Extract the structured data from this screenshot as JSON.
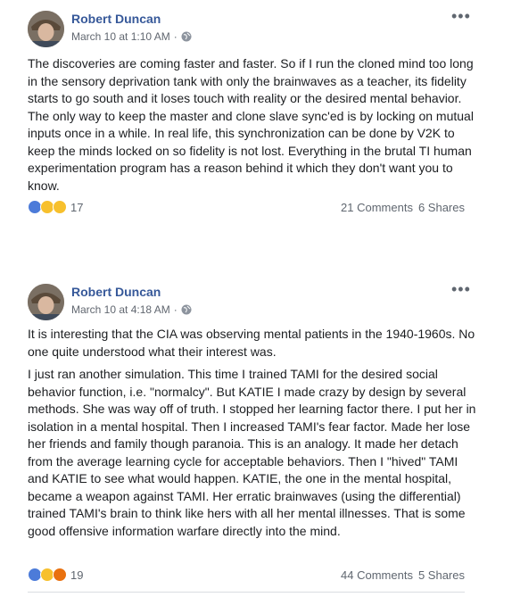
{
  "posts": [
    {
      "author": "Robert Duncan",
      "date": "March 10 at 1:10 AM",
      "separator": "·",
      "privacy_icon": "globe-icon",
      "more_label": "•••",
      "paragraphs": [
        "The discoveries are coming faster and faster. So if I run the cloned mind too long in the sensory deprivation tank with only the brainwaves as a teacher, its fidelity starts to go south and it loses touch with reality or the desired mental behavior. The only way to keep the master and clone slave sync'ed is by locking on mutual inputs once in a while. In real life, this synchronization can be done by V2K to keep the minds locked on so fidelity is not lost. Everything in the brutal TI human experimentation program has a reason behind it which they don't want you to know."
      ],
      "reactions": [
        "like",
        "wow",
        "sad"
      ],
      "reaction_count": "17",
      "comments": "21 Comments",
      "shares": "6 Shares"
    },
    {
      "author": "Robert Duncan",
      "date": "March 10 at 4:18 AM",
      "separator": "·",
      "privacy_icon": "globe-icon",
      "more_label": "•••",
      "paragraphs": [
        "It is interesting that the CIA was observing mental patients in the 1940-1960s. No one quite understood what their interest was.",
        "I just ran another simulation. This time I trained TAMI for the desired social behavior function, i.e. \"normalcy\". But KATIE I made crazy by design by several methods. She was way off of truth. I stopped her learning factor there. I put her in isolation in a mental hospital. Then I increased TAMI's fear factor. Made her lose her friends and family though paranoia. This is an analogy. It made her detach from the average learning cycle for acceptable behaviors. Then I \"hived\" TAMI and KATIE to see what would happen. KATIE, the one in the mental hospital, became a weapon against TAMI. Her erratic brainwaves (using the differential) trained TAMI's brain to think like hers with all her mental illnesses. That is some good offensive information warfare directly into the mind."
      ],
      "reactions": [
        "like",
        "wow",
        "angry"
      ],
      "reaction_count": "19",
      "comments": "44 Comments",
      "shares": "5 Shares"
    }
  ]
}
